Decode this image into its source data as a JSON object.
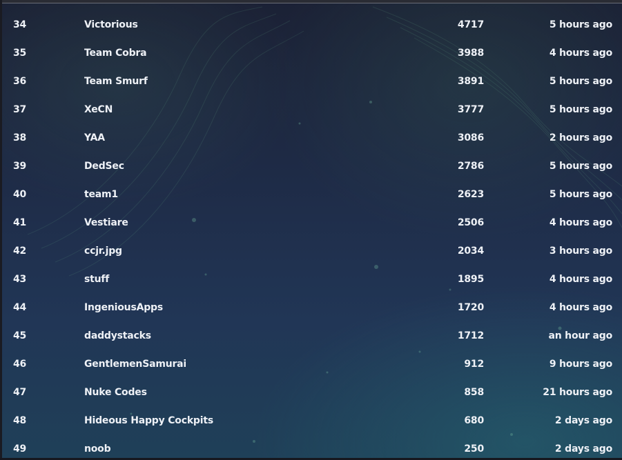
{
  "leaderboard": {
    "rows": [
      {
        "rank": "34",
        "team": "Victorious",
        "score": "4717",
        "last_submit": "5 hours ago"
      },
      {
        "rank": "35",
        "team": "Team Cobra",
        "score": "3988",
        "last_submit": "4 hours ago"
      },
      {
        "rank": "36",
        "team": "Team Smurf",
        "score": "3891",
        "last_submit": "5 hours ago"
      },
      {
        "rank": "37",
        "team": "XeCN",
        "score": "3777",
        "last_submit": "5 hours ago"
      },
      {
        "rank": "38",
        "team": "YAA",
        "score": "3086",
        "last_submit": "2 hours ago"
      },
      {
        "rank": "39",
        "team": "DedSec",
        "score": "2786",
        "last_submit": "5 hours ago"
      },
      {
        "rank": "40",
        "team": "team1",
        "score": "2623",
        "last_submit": "5 hours ago"
      },
      {
        "rank": "41",
        "team": "Vestiare",
        "score": "2506",
        "last_submit": "4 hours ago"
      },
      {
        "rank": "42",
        "team": "ccjr.jpg",
        "score": "2034",
        "last_submit": "3 hours ago"
      },
      {
        "rank": "43",
        "team": "stuff",
        "score": "1895",
        "last_submit": "4 hours ago"
      },
      {
        "rank": "44",
        "team": "IngeniousApps",
        "score": "1720",
        "last_submit": "4 hours ago"
      },
      {
        "rank": "45",
        "team": "daddystacks",
        "score": "1712",
        "last_submit": "an hour ago"
      },
      {
        "rank": "46",
        "team": "GentlemenSamurai",
        "score": "912",
        "last_submit": "9 hours ago"
      },
      {
        "rank": "47",
        "team": "Nuke Codes",
        "score": "858",
        "last_submit": "21 hours ago"
      },
      {
        "rank": "48",
        "team": "Hideous Happy Cockpits",
        "score": "680",
        "last_submit": "2 days ago"
      },
      {
        "rank": "49",
        "team": "noob",
        "score": "250",
        "last_submit": "2 days ago"
      }
    ]
  },
  "colors": {
    "background_top": "#1b2135",
    "background_bottom": "#1f4058",
    "text": "#eef1f6",
    "particle": "#4f8f76"
  }
}
